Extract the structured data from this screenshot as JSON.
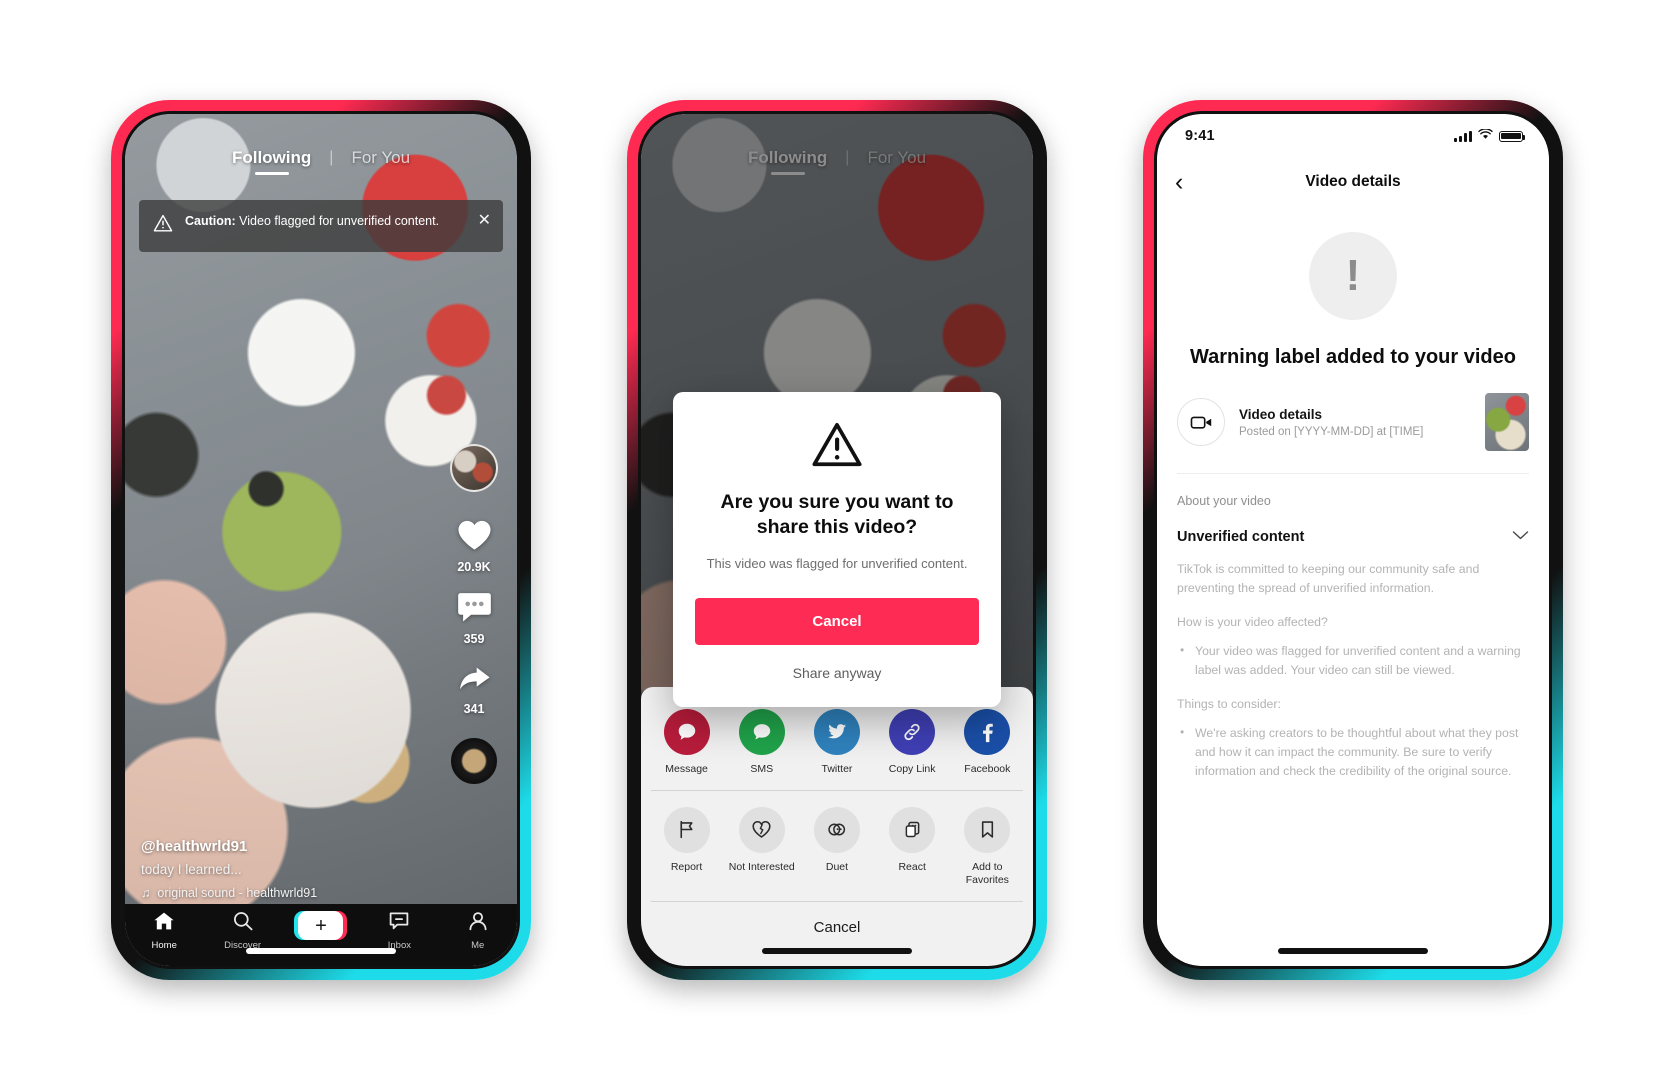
{
  "phone1": {
    "feed": {
      "tab_following": "Following",
      "tab_separator": "|",
      "tab_foryou": "For You",
      "caution_bold": "Caution:",
      "caution_text": " Video flagged for unverified content.",
      "close_icon": "close-icon",
      "likes": "20.9K",
      "comments": "359",
      "shares": "341",
      "username": "@healthwrld91",
      "caption": "today I learned...",
      "sound_icon": "music-note-icon",
      "sound": "original sound - healthwrld91"
    },
    "tabbar": [
      {
        "label": "Home",
        "icon": "home-icon"
      },
      {
        "label": "Discover",
        "icon": "search-icon"
      },
      {
        "label": "",
        "icon": "create-plus-icon"
      },
      {
        "label": "Inbox",
        "icon": "inbox-icon"
      },
      {
        "label": "Me",
        "icon": "person-icon"
      }
    ]
  },
  "phone2": {
    "feed": {
      "tab_following": "Following",
      "tab_separator": "|",
      "tab_foryou": "For You"
    },
    "modal": {
      "warning_icon": "warning-triangle-icon",
      "title": "Are you sure you want to share this video?",
      "body": "This video was flagged for unverified content.",
      "primary_label": "Cancel",
      "secondary_label": "Share anyway"
    },
    "share_sheet": {
      "share_targets": [
        {
          "label": "Message",
          "color": "#b81c3b",
          "icon": "message-icon"
        },
        {
          "label": "SMS",
          "color": "#20a34a",
          "icon": "sms-icon"
        },
        {
          "label": "Twitter",
          "color": "#2f82bd",
          "icon": "twitter-icon"
        },
        {
          "label": "Copy Link",
          "color": "#3f3fb5",
          "icon": "link-icon"
        },
        {
          "label": "Facebook",
          "color": "#1a4fa8",
          "icon": "facebook-icon"
        }
      ],
      "actions": [
        {
          "label": "Report",
          "icon": "flag-icon"
        },
        {
          "label": "Not Interested",
          "icon": "broken-heart-icon"
        },
        {
          "label": "Duet",
          "icon": "duet-icon"
        },
        {
          "label": "React",
          "icon": "react-icon"
        },
        {
          "label": "Add to Favorites",
          "icon": "bookmark-icon"
        }
      ],
      "cancel_label": "Cancel"
    }
  },
  "phone3": {
    "status": {
      "time": "9:41",
      "signal_icon": "cellular-icon",
      "wifi_icon": "wifi-icon",
      "battery_icon": "battery-icon"
    },
    "nav": {
      "back_icon": "chevron-left-icon",
      "title": "Video details"
    },
    "hero": {
      "icon": "exclamation-icon",
      "heading": "Warning label added to your video"
    },
    "video_row": {
      "icon": "video-camera-icon",
      "title": "Video details",
      "subtitle": "Posted on [YYYY-MM-DD] at [TIME]",
      "thumbnail": "video-thumbnail"
    },
    "about_label": "About your video",
    "accordion": {
      "title": "Unverified content",
      "chevron_icon": "chevron-down-icon"
    },
    "paragraphs": {
      "intro": "TikTok is committed to keeping our community safe and preventing the spread of unverified information.",
      "affected_heading": "How is your video affected?",
      "affected_bullet": "Your video was flagged for unverified content and a warning label was added. Your video can still be viewed.",
      "consider_heading": "Things to consider:",
      "consider_bullet": "We're asking creators to be thoughtful about what they post and how it can impact the community. Be sure to verify information and check the credibility of the original source."
    }
  },
  "theme": {
    "accent": "#fe2c55",
    "cyan": "#21e5ee",
    "sheet_bg": "#f1f1f1",
    "text_muted": "#b3b3b3"
  }
}
